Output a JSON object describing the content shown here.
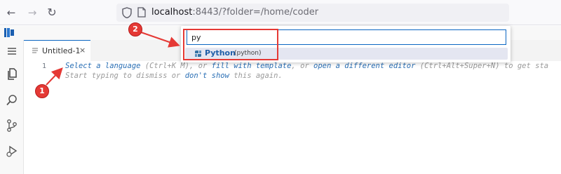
{
  "browser": {
    "url_host": "localhost",
    "url_rest": ":8443/?folder=/home/coder"
  },
  "tabs": [
    {
      "label": "Untitled-1",
      "close_glyph": "×"
    }
  ],
  "editor": {
    "line_number": "1",
    "hint_line1": [
      {
        "text": "Select a language",
        "link": true
      },
      {
        "text": " (Ctrl+K M), or ",
        "link": false
      },
      {
        "text": "fill with template",
        "link": true
      },
      {
        "text": ", or ",
        "link": false
      },
      {
        "text": "open a different editor",
        "link": true
      },
      {
        "text": " (Ctrl+Alt+Super+N) to get sta",
        "link": false
      }
    ],
    "hint_line2": [
      {
        "text": "Start typing to dismiss or ",
        "link": false
      },
      {
        "text": "don't show",
        "link": true
      },
      {
        "text": " this again.",
        "link": false
      }
    ]
  },
  "quick_pick": {
    "input_value": "py",
    "items": [
      {
        "label": "Python",
        "description": "(python)"
      }
    ]
  },
  "annotations": {
    "step1": "1",
    "step2": "2",
    "color": "#e53935"
  },
  "icons": [
    "back-arrow-icon",
    "forward-arrow-icon",
    "reload-icon",
    "shield-icon",
    "page-icon",
    "vscode-logo-icon",
    "menu-icon",
    "files-icon",
    "search-icon",
    "source-control-icon",
    "run-debug-icon",
    "python-icon"
  ]
}
